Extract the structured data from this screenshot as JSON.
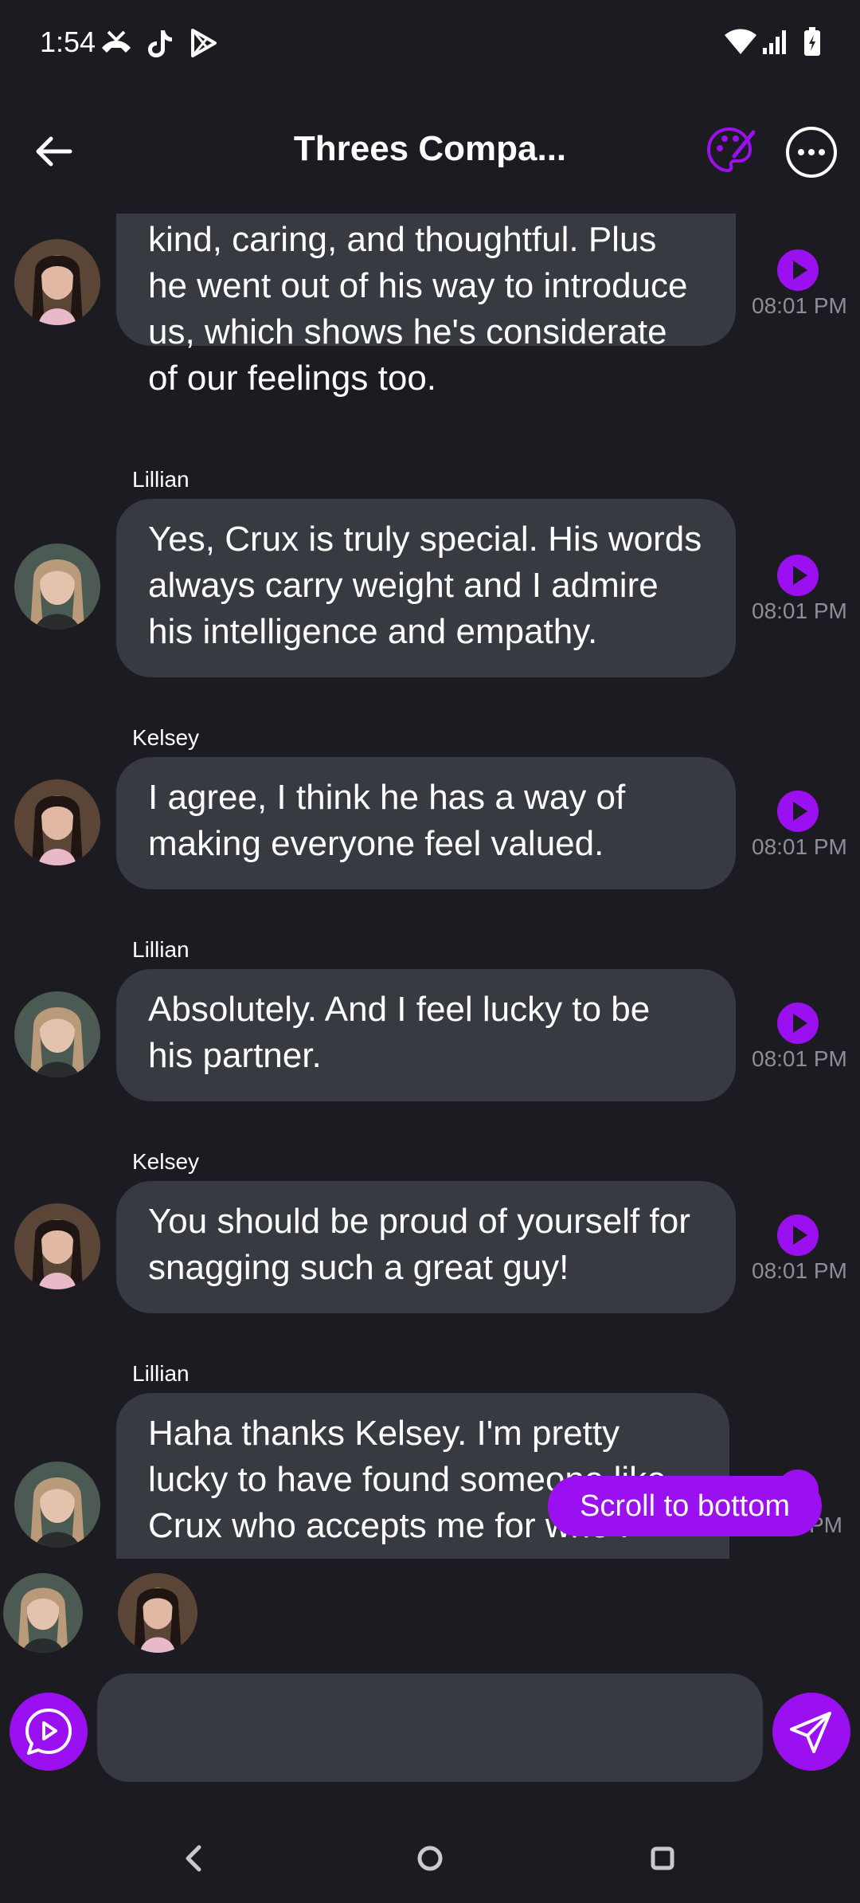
{
  "status_bar": {
    "time": "1:54",
    "icons": [
      "missed-call-icon",
      "tiktok-icon",
      "play-store-icon",
      "wifi-icon",
      "signal-icon",
      "battery-charging-icon"
    ]
  },
  "header": {
    "title": "Threes Compa...",
    "back_icon": "arrow-left-icon",
    "palette_icon": "palette-icon",
    "more_icon": "more-horizontal-icon"
  },
  "colors": {
    "background": "#1b1b21",
    "bubble": "#383a42",
    "accent": "#9b10f0",
    "timestamp": "#8d8e96"
  },
  "messages": [
    {
      "sender": "",
      "avatar": "kelsey",
      "text": "kind, caring, and thoughtful. Plus he went out of his way to introduce us, which shows he's considerate of our feelings too.",
      "time": "08:01 PM"
    },
    {
      "sender": "Lillian",
      "avatar": "lillian",
      "text": "Yes, Crux is truly special. His words always carry weight and I admire his intelligence and empathy.",
      "time": "08:01 PM"
    },
    {
      "sender": "Kelsey",
      "avatar": "kelsey",
      "text": "I agree, I think he has a way of making everyone feel valued.",
      "time": "08:01 PM"
    },
    {
      "sender": "Lillian",
      "avatar": "lillian",
      "text": "Absolutely. And I feel lucky to be his partner.",
      "time": "08:01 PM"
    },
    {
      "sender": "Kelsey",
      "avatar": "kelsey",
      "text": "You should be proud of yourself for snagging such a great guy!",
      "time": "08:01 PM"
    },
    {
      "sender": "Lillian",
      "avatar": "lillian",
      "text": "Haha thanks Kelsey. I'm pretty lucky to have found someone like Crux who accepts me for who I",
      "time": "PM"
    }
  ],
  "scroll_to_bottom": "Scroll to bottom",
  "composer": {
    "placeholder": "",
    "value": "",
    "voice_icon": "voice-message-icon",
    "send_icon": "send-icon"
  },
  "nav": {
    "icons": [
      "nav-back-icon",
      "nav-home-icon",
      "nav-recents-icon"
    ]
  }
}
